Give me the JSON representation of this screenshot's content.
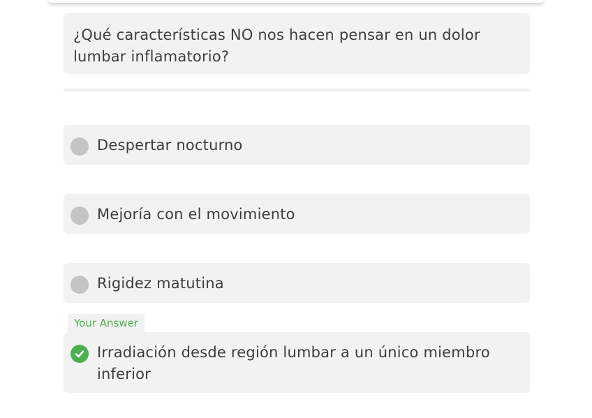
{
  "question": {
    "text": "¿Qué características NO nos hacen pensar en un dolor lumbar inflamatorio?"
  },
  "options": [
    {
      "label": "Despertar nocturno",
      "selected": false
    },
    {
      "label": "Mejoría con el movimiento",
      "selected": false
    },
    {
      "label": "Rigidez matutina",
      "selected": false
    },
    {
      "label": "Irradiación desde región lumbar a un único miembro inferior",
      "selected": true
    }
  ],
  "your_answer_badge": "Your Answer",
  "colors": {
    "card_background": "#f2f2f2",
    "radio_unselected": "#c4c4c4",
    "correct_green": "#4caf50",
    "text": "#3d3d3d"
  },
  "icons": {
    "selected_option": "check-circle-icon",
    "unselected_option": "radio-unchecked-icon"
  }
}
